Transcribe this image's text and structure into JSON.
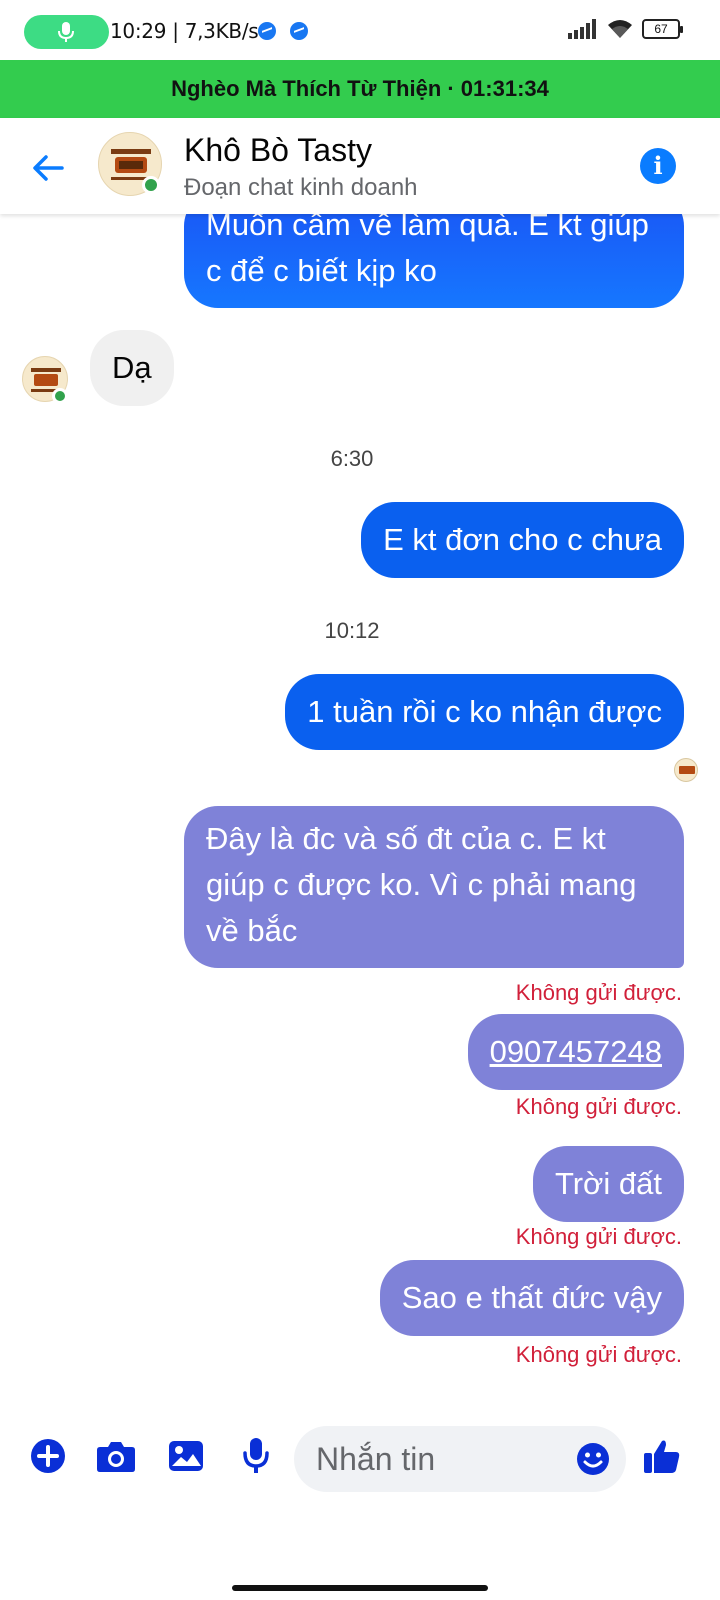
{
  "status_bar": {
    "time_speed": "10:29 | 7,3KB/s",
    "battery": "67"
  },
  "call_banner": {
    "text": "Nghèo Mà Thích Từ Thiện · 01:31:34"
  },
  "header": {
    "title": "Khô Bò Tasty",
    "subtitle": "Đoạn chat kinh doanh"
  },
  "messages": {
    "m0": "Muốn cầm về làm quà. E kt giúp c để c biết kịp ko",
    "m1": "Dạ",
    "t1": "6:30",
    "m2": "E kt đơn cho c chưa",
    "t2": "10:12",
    "m3": "1 tuần rồi c ko nhận được",
    "m4": "Đây là đc và số đt của c. E kt giúp c được ko. Vì c phải mang về bắc",
    "e4": "Không gửi được.",
    "m5": "0907457248",
    "e5": "Không gửi được.",
    "m6": "Trời đất",
    "e6": "Không gửi được.",
    "m7": "Sao e thất đức vậy",
    "e7": "Không gửi được."
  },
  "composer": {
    "placeholder": "Nhắn tin"
  },
  "colors": {
    "messenger_blue": "#0a60ef",
    "failed_bubble": "#7f82d8",
    "error_red": "#d1203a",
    "banner_green": "#33cc4e",
    "icon_blue": "#0a2fd6"
  }
}
